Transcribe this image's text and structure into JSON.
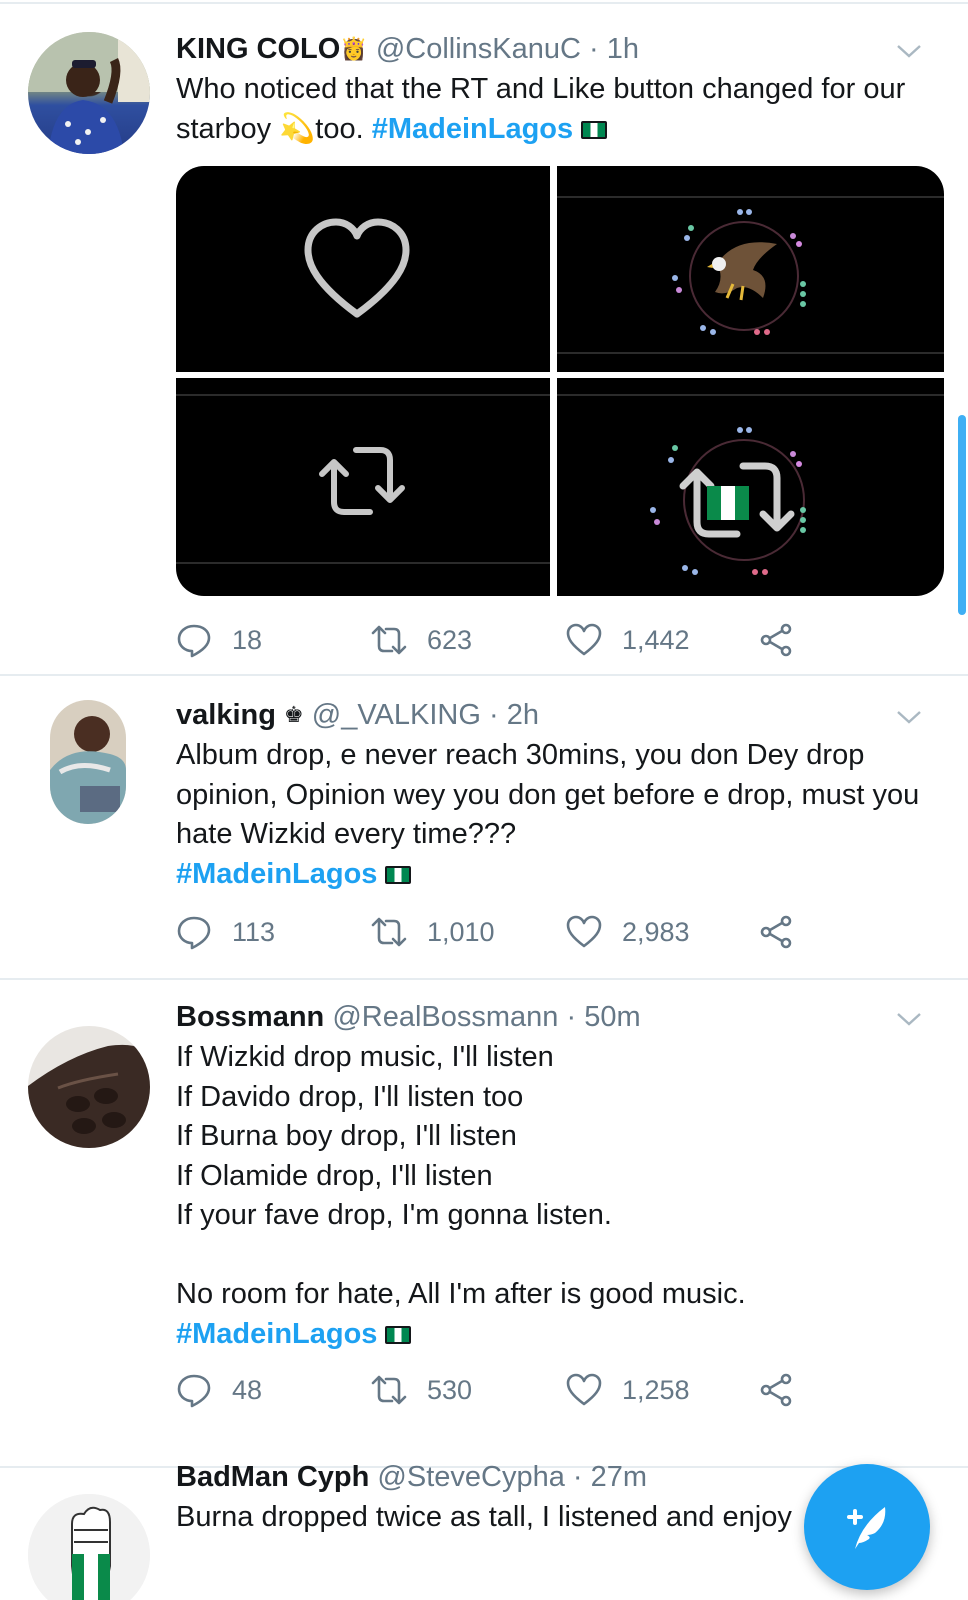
{
  "tweets": [
    {
      "name": "KING COLO",
      "name_badge": "👸",
      "handle": "@CollinsKanuC",
      "separator": "·",
      "time": "1h",
      "text": "Who noticed that the RT and Like button changed for our starboy 💫too. ",
      "hashtag": "#MadeinLagos",
      "replies": "18",
      "retweets": "623",
      "likes": "1,442"
    },
    {
      "name": "valking",
      "name_badge": "♚",
      "handle": "@_VALKING",
      "separator": "·",
      "time": "2h",
      "text": "Album drop, e never reach 30mins, you don Dey drop opinion, Opinion wey you don get before e drop, must you hate Wizkid every time???",
      "hashtag": "#MadeinLagos",
      "replies": "113",
      "retweets": "1,010",
      "likes": "2,983"
    },
    {
      "name": "Bossmann",
      "handle": "@RealBossmann",
      "separator": "·",
      "time": "50m",
      "text": "If Wizkid drop music, I'll listen\nIf Davido drop, I'll listen too\nIf Burna boy drop, I'll listen\nIf Olamide drop, I'll listen\nIf your fave drop, I'm gonna listen.\n\nNo room for hate, All I'm after is good music.",
      "hashtag": "#MadeinLagos",
      "replies": "48",
      "retweets": "530",
      "likes": "1,258"
    },
    {
      "name": "BadMan Cyph",
      "handle": "@SteveCypha",
      "separator": "·",
      "time": "27m",
      "text": "Burna dropped twice as tall, I listened and enjoy"
    }
  ],
  "icons": {
    "reply": "reply-icon",
    "retweet": "retweet-icon",
    "like": "heart-icon",
    "share": "share-icon",
    "caret": "chevron-down-icon",
    "compose": "compose-tweet-icon"
  },
  "colors": {
    "accent": "#1da1f2",
    "secondary_text": "#657786",
    "divider": "#e6ecf0"
  }
}
